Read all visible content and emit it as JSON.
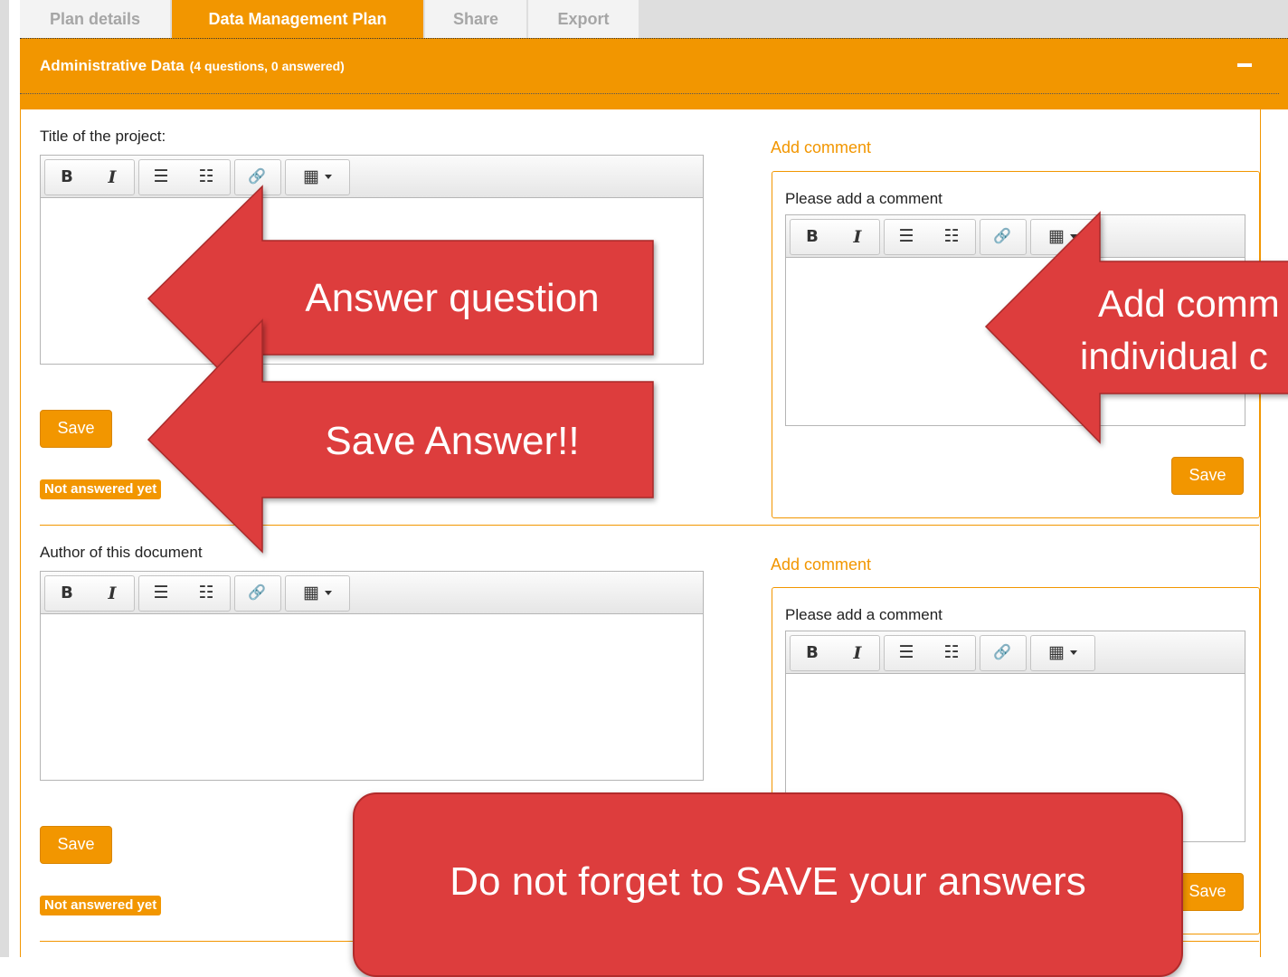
{
  "tabs": [
    {
      "label": "Plan details",
      "active": false
    },
    {
      "label": "Data Management Plan",
      "active": true
    },
    {
      "label": "Share",
      "active": false
    },
    {
      "label": "Export",
      "active": false
    }
  ],
  "section": {
    "title": "Administrative Data",
    "meta": "(4 questions, 0 answered)",
    "collapse_icon": "minus-icon"
  },
  "questions": [
    {
      "label": "Title of the project:",
      "save_label": "Save",
      "status": "Not answered yet",
      "comment": {
        "header": "Add comment",
        "prompt": "Please add a comment",
        "save_label": "Save"
      }
    },
    {
      "label": "Author of this document",
      "save_label": "Save",
      "status": "Not answered yet",
      "comment": {
        "header": "Add comment",
        "prompt": "Please add a comment",
        "save_label": "Save"
      }
    }
  ],
  "toolbar": {
    "bold": "B",
    "italic": "I",
    "bullet_list": "☰",
    "numbered_list": "☷",
    "link": "🔗",
    "table": "▦"
  },
  "annotations": {
    "answer_question": "Answer question",
    "save_answer": "Save Answer!!",
    "add_comment_line1": "Add comm",
    "add_comment_line2": "individual c",
    "reminder": "Do not forget to SAVE your answers"
  },
  "colors": {
    "accent": "#f29600",
    "callout": "#dd3d3d"
  }
}
